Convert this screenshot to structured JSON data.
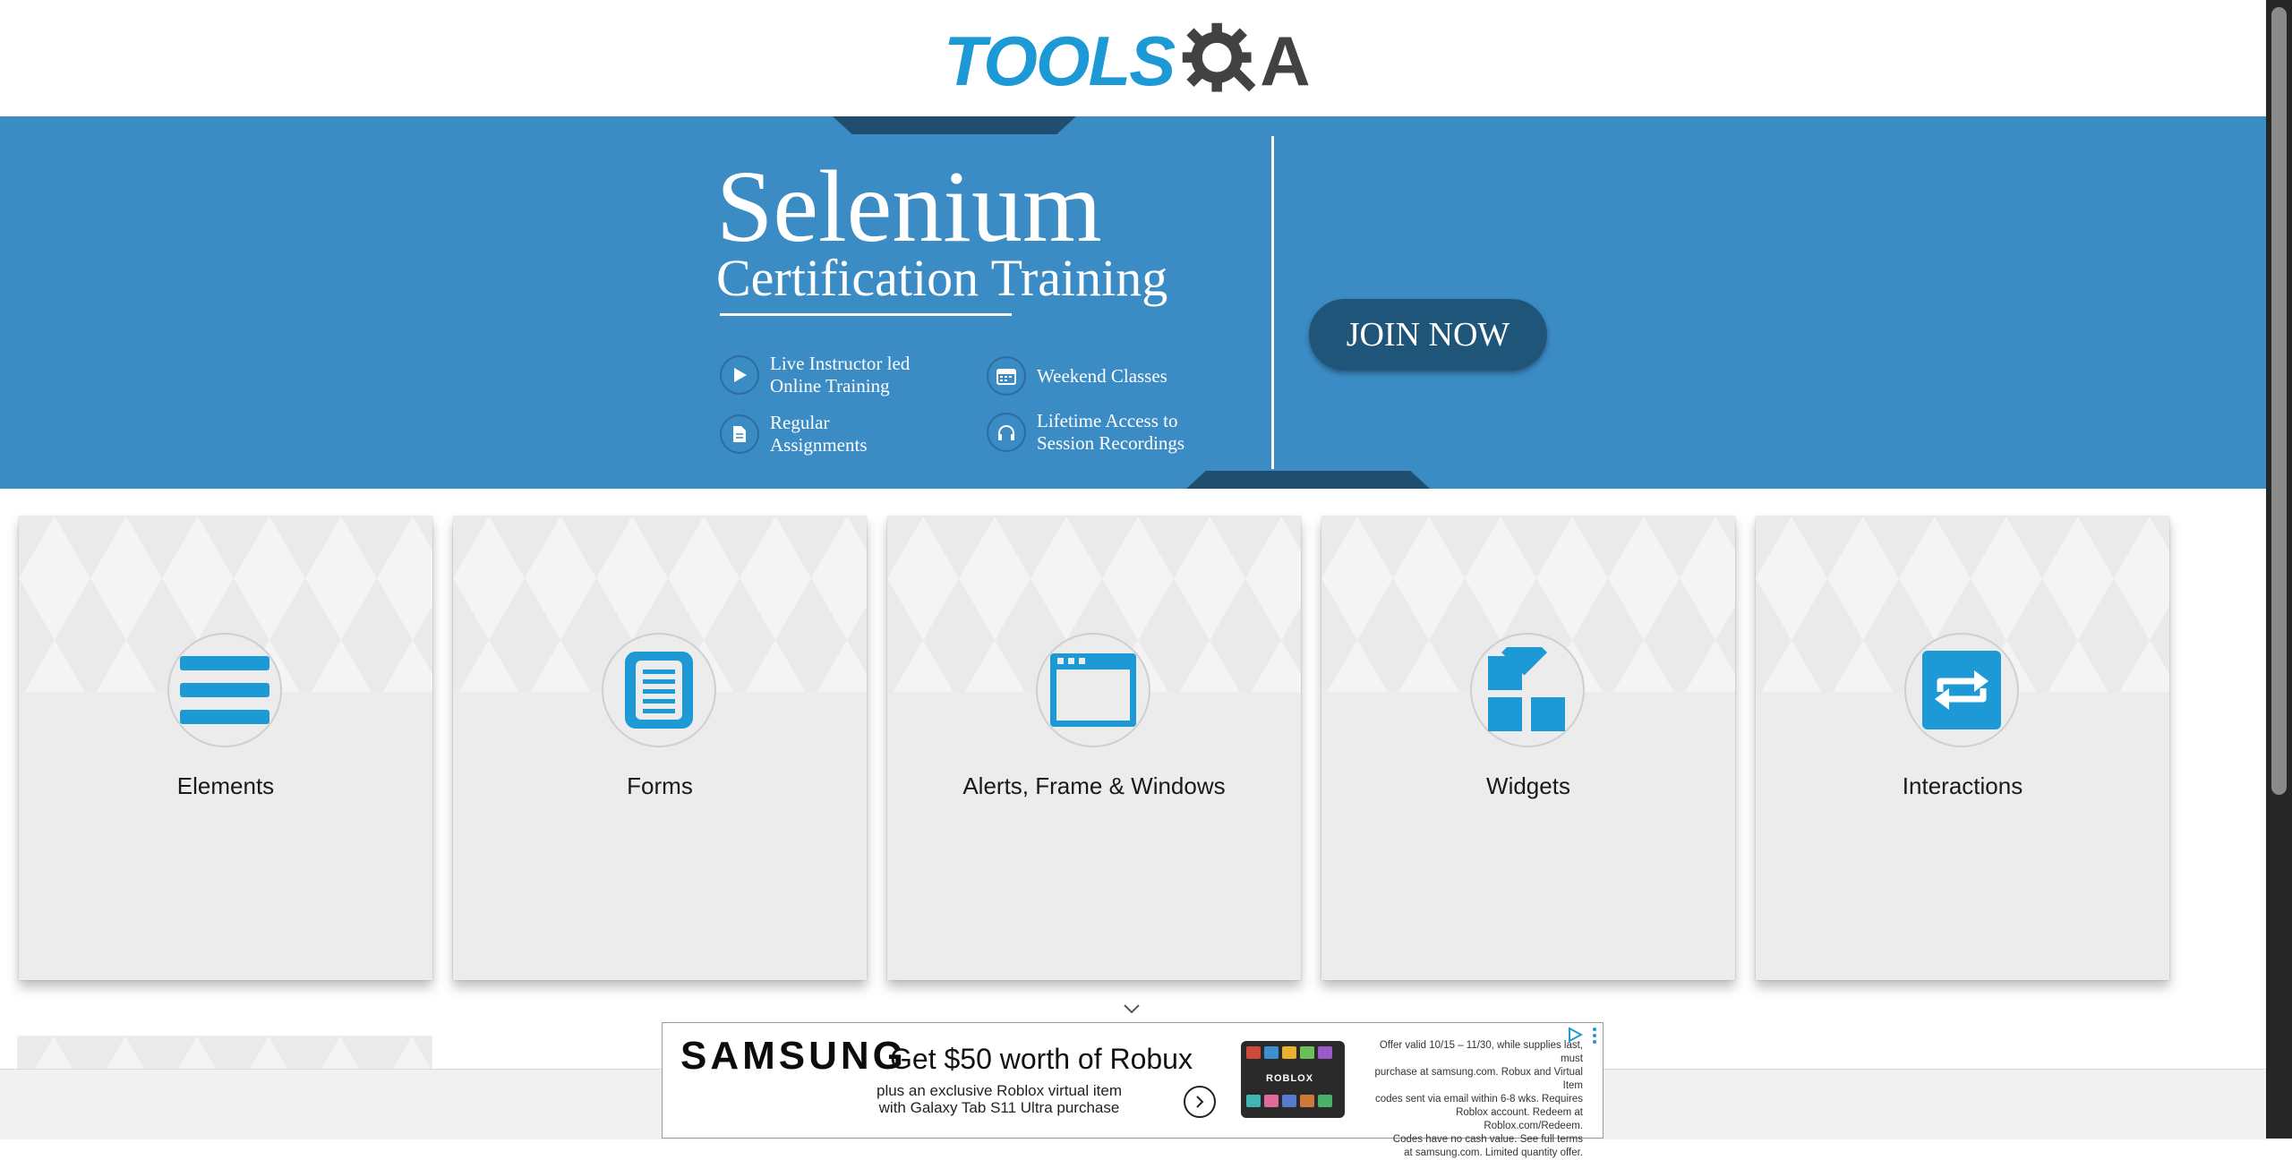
{
  "header": {
    "logo_part1": "TOOLS",
    "logo_part2": "A"
  },
  "banner": {
    "title": "Selenium",
    "subtitle": "Certification Training",
    "features": [
      {
        "text": "Live Instructor led\nOnline Training",
        "icon": "play-icon"
      },
      {
        "text": "Weekend Classes",
        "icon": "calendar-icon"
      },
      {
        "text": "Regular\nAssignments",
        "icon": "document-icon"
      },
      {
        "text": "Lifetime Access to\nSession Recordings",
        "icon": "headphones-icon"
      }
    ],
    "join_label": "JOIN NOW",
    "colors": {
      "background": "#3b8bc5",
      "accent": "#1f4e6f",
      "button": "#1f5578"
    }
  },
  "cards": [
    {
      "label": "Elements",
      "icon": "hamburger-list-icon"
    },
    {
      "label": "Forms",
      "icon": "form-document-icon"
    },
    {
      "label": "Alerts, Frame & Windows",
      "icon": "browser-window-icon"
    },
    {
      "label": "Widgets",
      "icon": "widgets-grid-icon"
    },
    {
      "label": "Interactions",
      "icon": "swap-arrows-icon"
    }
  ],
  "icon_color": "#1d9ad6",
  "ad": {
    "brand": "SAMSUNG",
    "headline": "Get $50 worth of Robux",
    "sub": "plus an exclusive Roblox virtual item\nwith Galaxy Tab S11 Ultra purchase",
    "product_label": "ROBLOX",
    "fine_print": "Offer valid 10/15 – 11/30, while supplies last, must\npurchase at samsung.com. Robux and Virtual Item\ncodes sent via email within 6-8 wks. Requires\nRoblox account. Redeem at Roblox.com/Redeem.\nCodes have no cash value. See full terms\nat samsung.com. Limited quantity offer."
  }
}
